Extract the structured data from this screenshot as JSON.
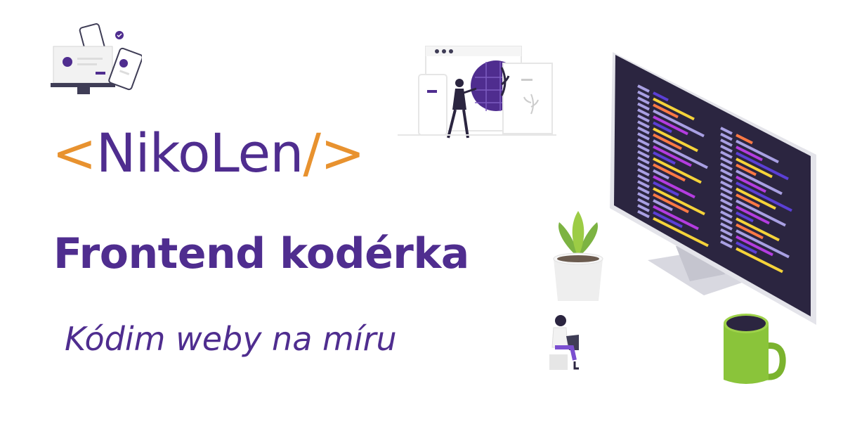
{
  "brand": {
    "open_bracket": "<",
    "name": "NikoLen",
    "close_bracket": "/>"
  },
  "headline": "Frontend kodérka",
  "tagline": "Kódim weby na míru",
  "colors": {
    "brand_purple": "#4f2d8f",
    "brand_orange": "#e8922f",
    "code_yellow": "#f5d33a",
    "code_purple": "#b43ce0",
    "code_blue": "#5b3fd6",
    "code_orange": "#ff7a45",
    "code_lavender": "#a9a0e3",
    "screen_dark": "#2b2540",
    "plant_green": "#8cc63f",
    "mug_green": "#8ac43a"
  },
  "illustrations": [
    "devices-illustration",
    "web-design-illustration",
    "code-monitor-illustration",
    "plant-pot-illustration",
    "coffee-mug-illustration",
    "person-laptop-illustration"
  ]
}
